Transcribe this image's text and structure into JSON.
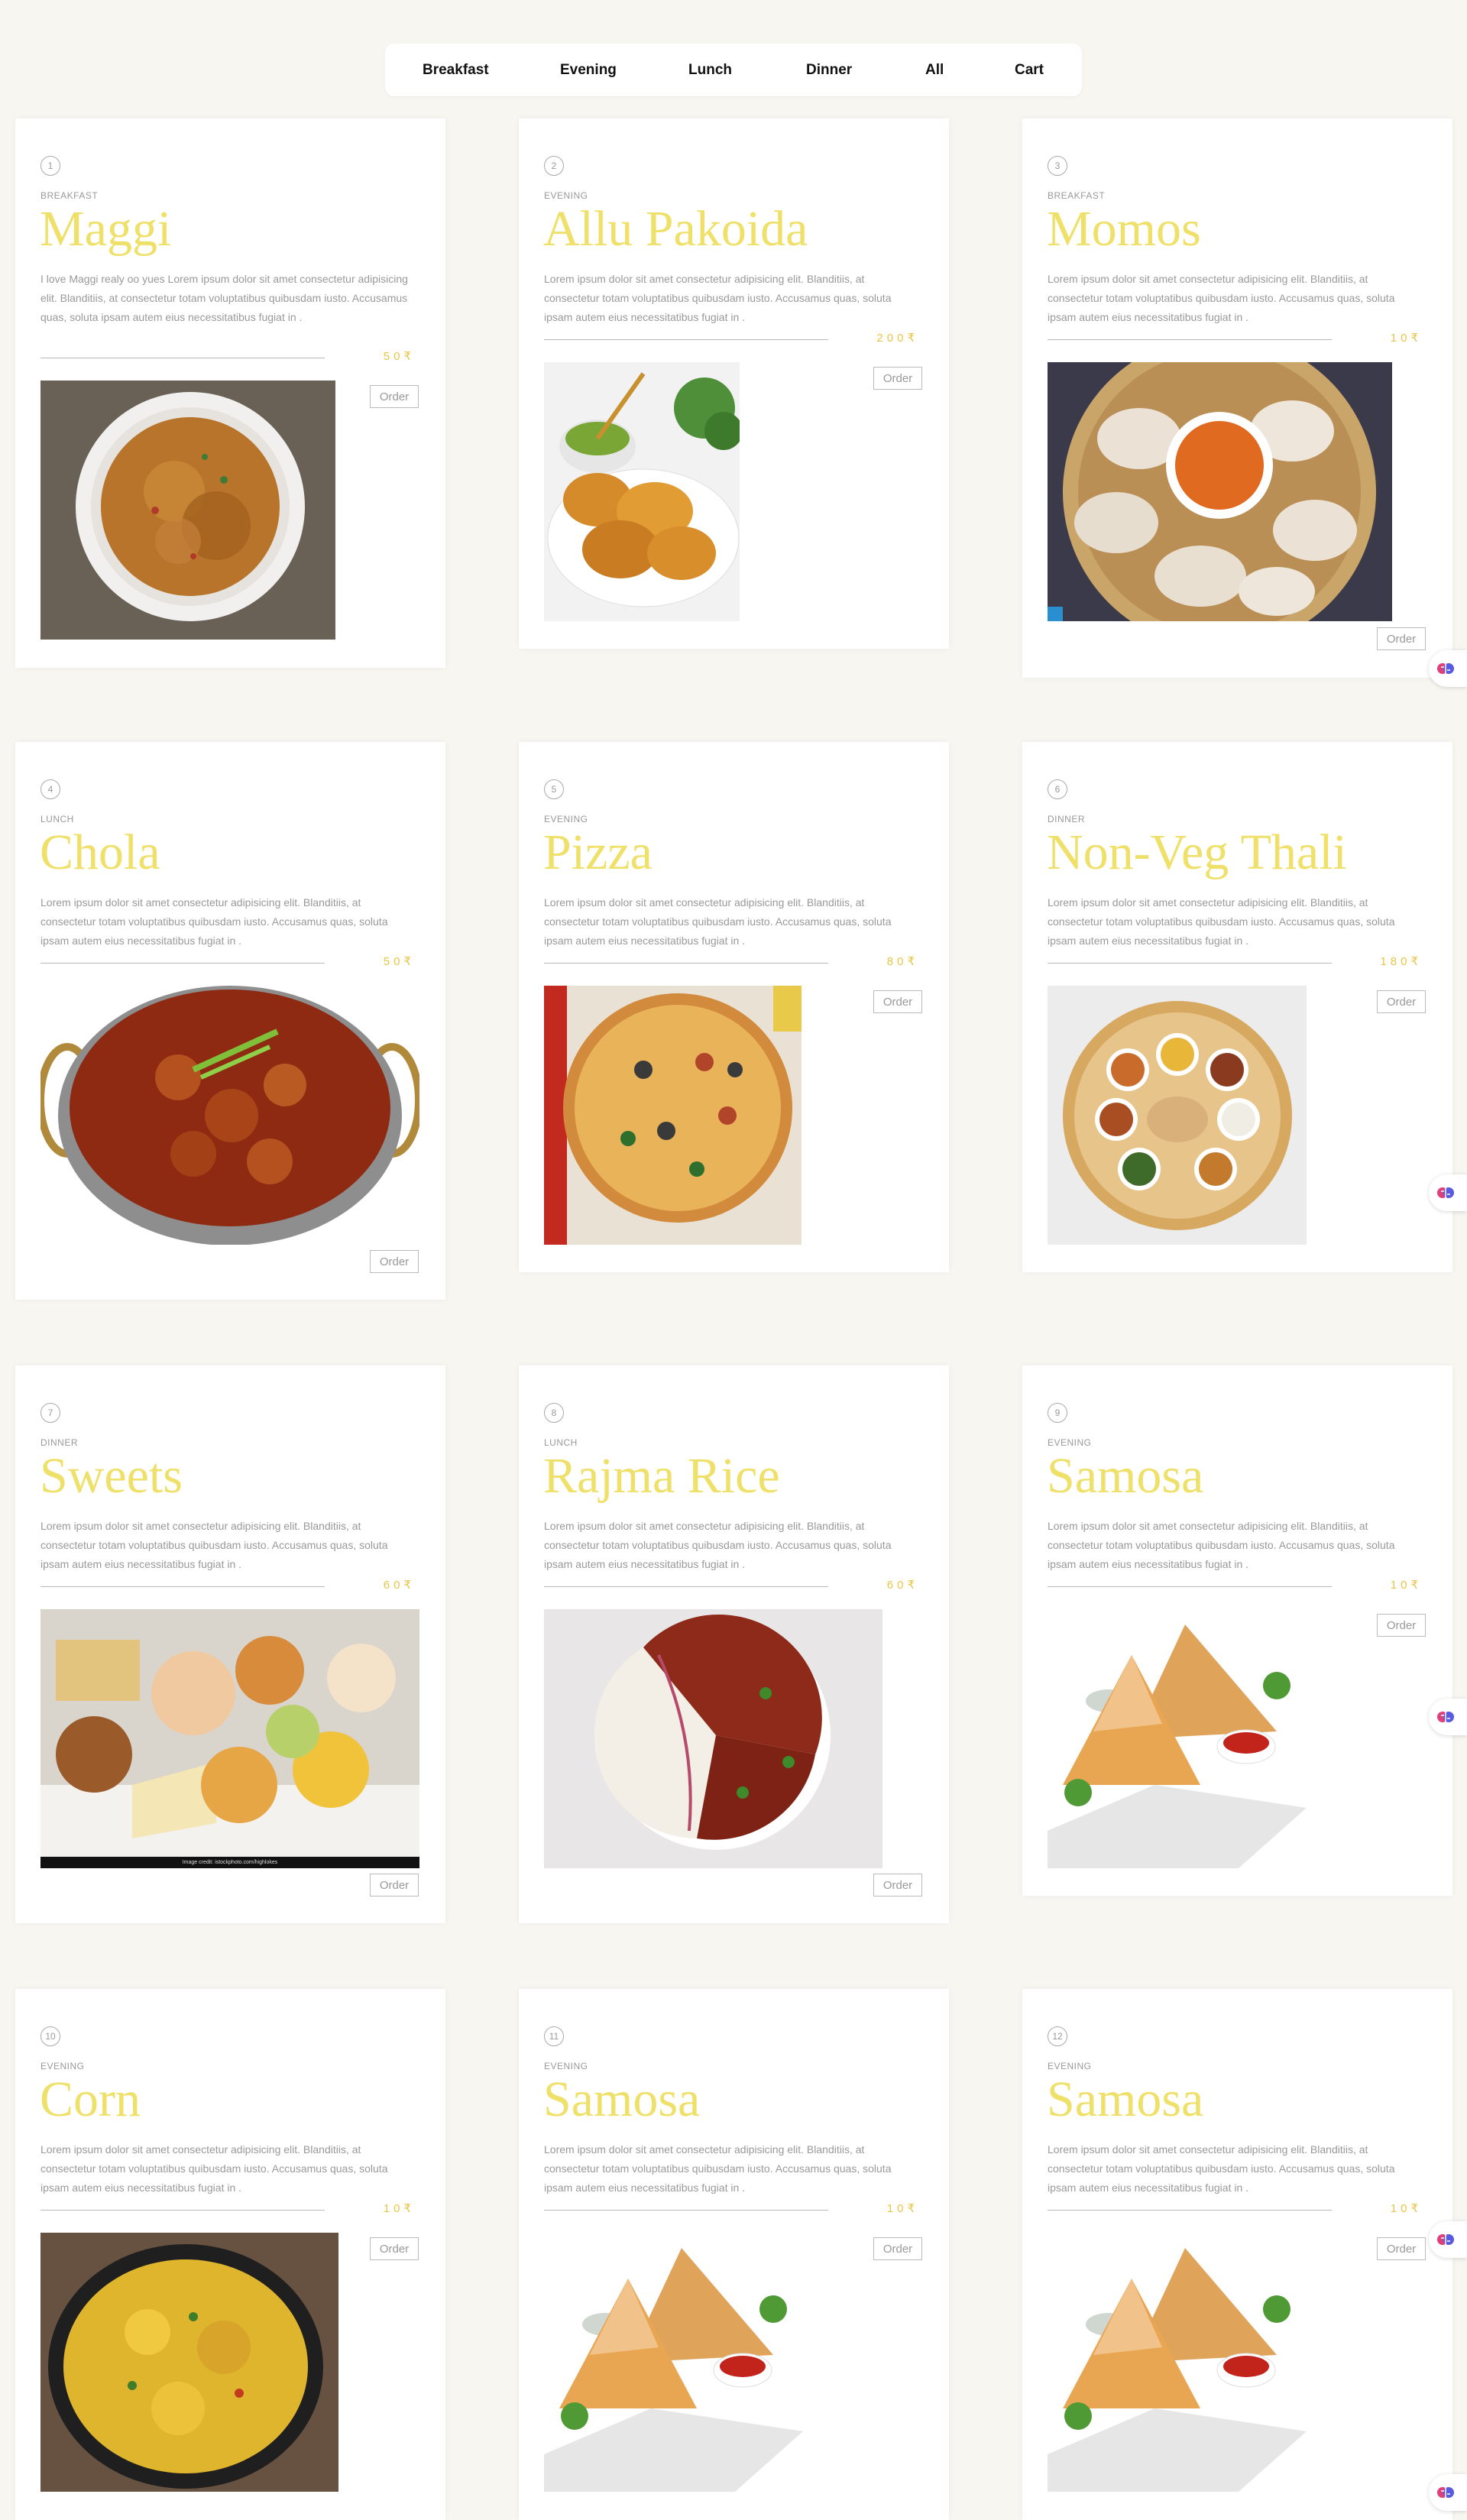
{
  "nav": {
    "items": [
      {
        "label": "Breakfast"
      },
      {
        "label": "Evening"
      },
      {
        "label": "Lunch"
      },
      {
        "label": "Dinner"
      },
      {
        "label": "All"
      },
      {
        "label": "Cart"
      }
    ]
  },
  "order_label": "Order",
  "cards": [
    {
      "num": "1",
      "category": "BREAKFAST",
      "title": "Maggi",
      "desc": "I love Maggi realy oo yues Lorem ipsum dolor sit amet consectetur adipisicing elit. Blanditiis, at consectetur totam voluptatibus quibusdam iusto. Accusamus quas, soluta ipsam autem eius necessitatibus fugiat in .",
      "price": "50₹"
    },
    {
      "num": "2",
      "category": "EVENING",
      "title": "Allu Pakoida",
      "desc": "Lorem ipsum dolor sit amet consectetur adipisicing elit. Blanditiis, at consectetur totam voluptatibus quibusdam iusto. Accusamus quas, soluta ipsam autem eius necessitatibus fugiat in .",
      "price": "200₹"
    },
    {
      "num": "3",
      "category": "BREAKFAST",
      "title": "Momos",
      "desc": "Lorem ipsum dolor sit amet consectetur adipisicing elit. Blanditiis, at consectetur totam voluptatibus quibusdam iusto. Accusamus quas, soluta ipsam autem eius necessitatibus fugiat in .",
      "price": "10₹"
    },
    {
      "num": "4",
      "category": "LUNCH",
      "title": "Chola",
      "desc": "Lorem ipsum dolor sit amet consectetur adipisicing elit. Blanditiis, at consectetur totam voluptatibus quibusdam iusto. Accusamus quas, soluta ipsam autem eius necessitatibus fugiat in .",
      "price": "50₹"
    },
    {
      "num": "5",
      "category": "EVENING",
      "title": "Pizza",
      "desc": "Lorem ipsum dolor sit amet consectetur adipisicing elit. Blanditiis, at consectetur totam voluptatibus quibusdam iusto. Accusamus quas, soluta ipsam autem eius necessitatibus fugiat in .",
      "price": "80₹"
    },
    {
      "num": "6",
      "category": "DINNER",
      "title": "Non-Veg Thali",
      "desc": "Lorem ipsum dolor sit amet consectetur adipisicing elit. Blanditiis, at consectetur totam voluptatibus quibusdam iusto. Accusamus quas, soluta ipsam autem eius necessitatibus fugiat in .",
      "price": "180₹"
    },
    {
      "num": "7",
      "category": "DINNER",
      "title": "Sweets",
      "desc": "Lorem ipsum dolor sit amet consectetur adipisicing elit. Blanditiis, at consectetur totam voluptatibus quibusdam iusto. Accusamus quas, soluta ipsam autem eius necessitatibus fugiat in .",
      "price": "60₹"
    },
    {
      "num": "8",
      "category": "LUNCH",
      "title": "Rajma Rice",
      "desc": "Lorem ipsum dolor sit amet consectetur adipisicing elit. Blanditiis, at consectetur totam voluptatibus quibusdam iusto. Accusamus quas, soluta ipsam autem eius necessitatibus fugiat in .",
      "price": "60₹"
    },
    {
      "num": "9",
      "category": "EVENING",
      "title": "Samosa",
      "desc": "Lorem ipsum dolor sit amet consectetur adipisicing elit. Blanditiis, at consectetur totam voluptatibus quibusdam iusto. Accusamus quas, soluta ipsam autem eius necessitatibus fugiat in .",
      "price": "10₹"
    },
    {
      "num": "10",
      "category": "EVENING",
      "title": "Corn",
      "desc": "Lorem ipsum dolor sit amet consectetur adipisicing elit. Blanditiis, at consectetur totam voluptatibus quibusdam iusto. Accusamus quas, soluta ipsam autem eius necessitatibus fugiat in .",
      "price": "10₹"
    },
    {
      "num": "11",
      "category": "EVENING",
      "title": "Samosa",
      "desc": "Lorem ipsum dolor sit amet consectetur adipisicing elit. Blanditiis, at consectetur totam voluptatibus quibusdam iusto. Accusamus quas, soluta ipsam autem eius necessitatibus fugiat in .",
      "price": "10₹"
    },
    {
      "num": "12",
      "category": "EVENING",
      "title": "Samosa",
      "desc": "Lorem ipsum dolor sit amet consectetur adipisicing elit. Blanditiis, at consectetur totam voluptatibus quibusdam iusto. Accusamus quas, soluta ipsam autem eius necessitatibus fugiat in .",
      "price": "10₹"
    }
  ],
  "photo_credit": "Image credit: istockphoto.com/highlokes",
  "colors": {
    "background": "#f8f6f1",
    "title": "#efe06a",
    "price": "#e8c547",
    "text": "#999999"
  },
  "icons": {
    "side_widget": "brain-icon"
  }
}
